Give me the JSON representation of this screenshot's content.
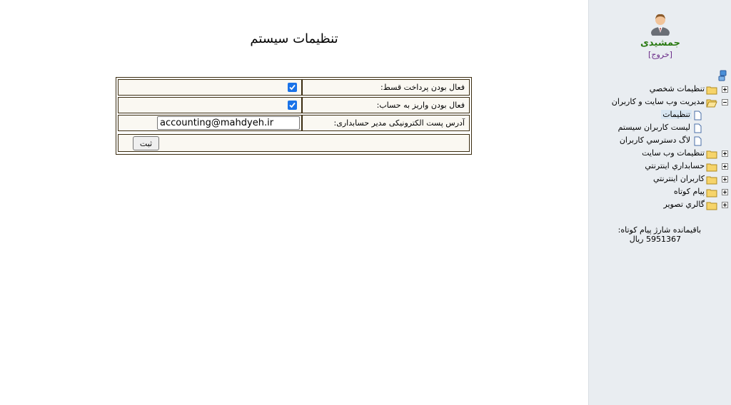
{
  "main": {
    "title": "تنظیمات سیستم",
    "fields": [
      {
        "label": "فعال بودن پرداخت قسط:",
        "checked": true
      },
      {
        "label": "فعال بودن واریز به حساب:",
        "checked": true
      },
      {
        "label": "آدرس پست الکترونیکی مدیر حسابداری:",
        "value": "accounting@mahdyeh.ir"
      }
    ],
    "submit_label": "ثبت"
  },
  "sidebar": {
    "user_name": "جمشیدی",
    "logout_label": "[خروج]",
    "tree": [
      {
        "label": "تنظيمات شخصي",
        "icon": "folder-icon",
        "expander": "plus"
      },
      {
        "label": "مديريت وب سايت و کاربران",
        "icon": "folder-open-icon",
        "expander": "minus"
      },
      {
        "label": "تنظیمات",
        "icon": "page-icon",
        "selected": true
      },
      {
        "label": "ليست کاربران سيستم",
        "icon": "page-icon"
      },
      {
        "label": "لاگ دسترسي کاربران",
        "icon": "page-icon"
      },
      {
        "label": "تنظيمات وب سايت",
        "icon": "folder-icon",
        "expander": "plus"
      },
      {
        "label": "حسابداري اينترنتي",
        "icon": "folder-icon",
        "expander": "plus"
      },
      {
        "label": "کاربران اينترنتي",
        "icon": "folder-icon",
        "expander": "plus"
      },
      {
        "label": "پيام کوتاه",
        "icon": "folder-icon",
        "expander": "plus"
      },
      {
        "label": "گالري تصوير",
        "icon": "folder-icon",
        "expander": "plus"
      }
    ],
    "sms_balance_label": "باقیمانده شارژ پیام کوتاه:",
    "sms_balance_value": "5951367 ریال"
  },
  "colors": {
    "sidebar_bg": "#e9edf1",
    "user_name": "#2a7a12",
    "checkbox_accent": "#1a73e8",
    "table_border": "#3a2c10",
    "cell_bg": "#faf8f2"
  }
}
